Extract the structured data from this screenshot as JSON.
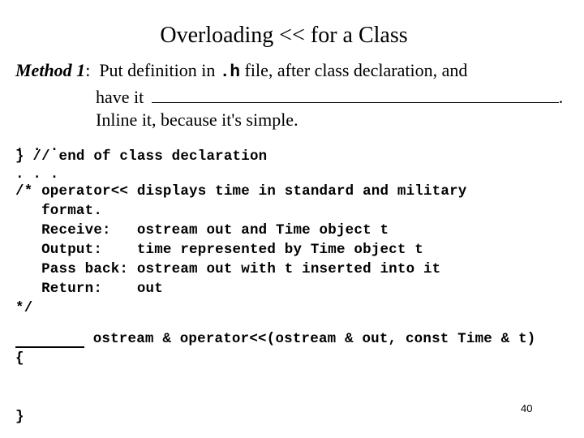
{
  "slide": {
    "title": "Overloading << for a Class",
    "method": {
      "label": "Method 1",
      "colon": ":",
      "text_before_code": "  Put definition in ",
      "code": ".h",
      "text_after_code": " file, after class declaration, and",
      "line2_prefix": "have it ",
      "line2_suffix": ".",
      "line3": "Inline it, because it's simple."
    },
    "code_lines": [
      ". . .",
      "} // end of class declaration",
      ". . .",
      "/* operator<< displays time in standard and military",
      "   format.",
      "   Receive:   ostream out and Time object t",
      "   Output:    time represented by Time object t",
      "   Pass back: ostream out with t inserted into it",
      "   Return:    out",
      "*/"
    ],
    "signature": " ostream & operator<<(ostream & out, const Time & t)",
    "open_brace": "{",
    "close_brace": "}",
    "page_number": "40"
  }
}
